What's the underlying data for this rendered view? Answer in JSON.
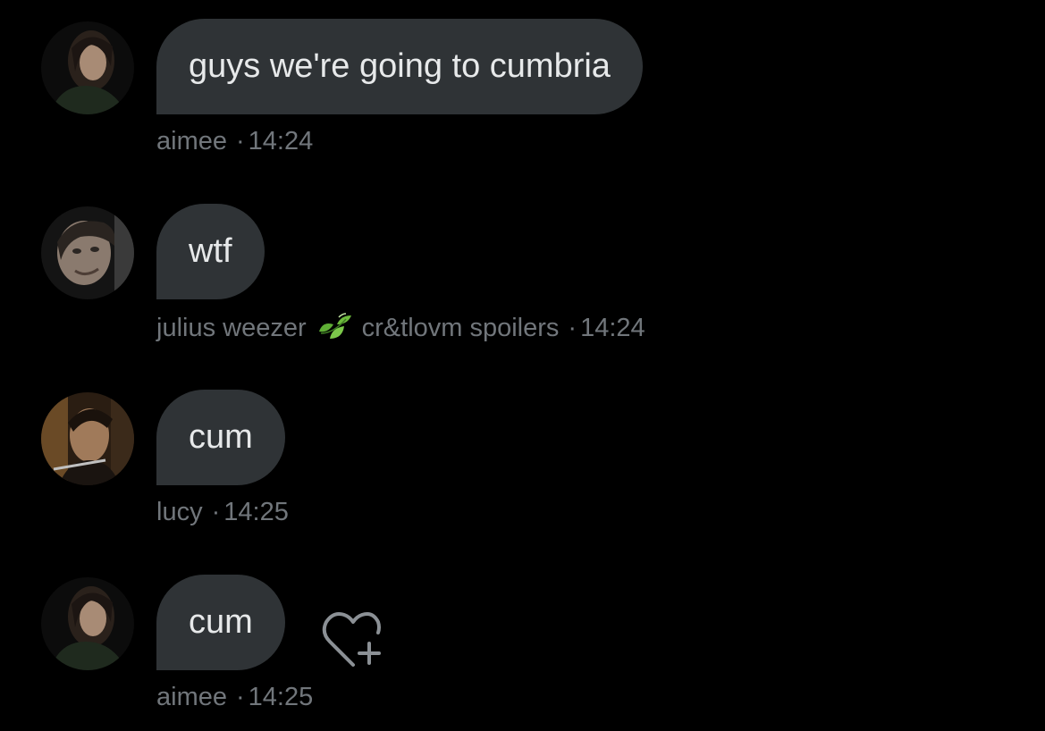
{
  "messages": [
    {
      "text": "guys we're going to cumbria",
      "sender": "aimee",
      "time": "14:24",
      "avatar_icon": "avatar-aimee"
    },
    {
      "text": "wtf",
      "sender": "julius weezer",
      "sender_extra": "cr&tlovm spoilers",
      "sender_emoji": "leaves-icon",
      "time": "14:24",
      "avatar_icon": "avatar-julius"
    },
    {
      "text": "cum",
      "sender": "lucy",
      "time": "14:25",
      "avatar_icon": "avatar-lucy"
    },
    {
      "text": "cum",
      "sender": "aimee",
      "time": "14:25",
      "avatar_icon": "avatar-aimee",
      "action_icon": "add-reaction-heart-icon"
    }
  ],
  "meta_separator": "·",
  "colors": {
    "background": "#000000",
    "bubble": "#2f3336",
    "text": "#e7e9ea",
    "meta": "#71767b",
    "leaf_green": "#6dbb3c"
  }
}
